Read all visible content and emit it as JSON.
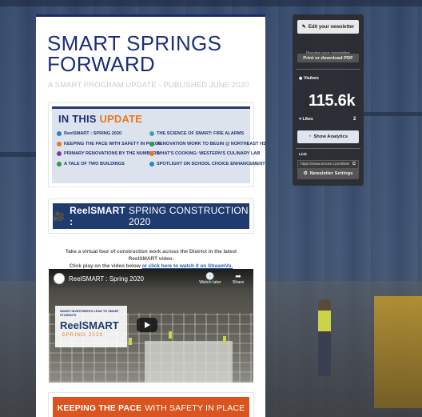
{
  "newsletter": {
    "title": "SMART SPRINGS FORWARD",
    "subtitle": "A SMART PROGRAM UPDATE - PUBLISHED JUNE 2020",
    "toc": {
      "heading_prefix": "IN THIS",
      "heading_accent": "UPDATE",
      "left_items": [
        {
          "label": "ReelSMART : SPRING 2020",
          "color": "#2a7fd0"
        },
        {
          "label": "KEEPING THE PACE WITH SAFETY IN PLACE",
          "color": "#e87722"
        },
        {
          "label": "PRIMARY RENOVATIONS BY THE NUMBERS",
          "color": "#7b3fa0"
        },
        {
          "label": "A TALE OF TWO BUILDINGS",
          "color": "#2f9a4a"
        }
      ],
      "right_items": [
        {
          "label": "THE SCIENCE OF SMART: FIRE ALARMS",
          "color": "#3aa6b0"
        },
        {
          "label": "RENOVATION WORK TO BEGIN @ NORTHEAST HS",
          "color": "#2f9a4a"
        },
        {
          "label": "WHAT'S COOKING: WESTERN'S CULINARY LAB",
          "color": "#e87722"
        },
        {
          "label": "SPOTLIGHT ON SCHOOL CHOICE ENHANCEMENTS",
          "color": "#2a7fd0"
        }
      ]
    },
    "reel_banner": {
      "bold": "ReelSMART :",
      "rest": "SPRING CONSTRUCTION 2020"
    },
    "intro": {
      "line1": "Take a virtual tour of construction work across the District in the latest ReelSMART video.",
      "line2_prefix": "Click play on the video below",
      "line2_link": "or click here to watch it on StreamVu."
    },
    "video": {
      "title": "ReelSMART : Spring 2020",
      "watch_later": "Watch later",
      "share": "Share",
      "card_small": "SMART INVESTMENTS LEAD TO SMART STUDENTS",
      "card_big": "ReelSMART",
      "card_season": "SPRING 2020"
    },
    "keep_banner": {
      "bold": "KEEPING THE PACE",
      "rest": "WITH SAFETY IN PLACE"
    }
  },
  "side_panel": {
    "edit_button": "Edit your newsletter",
    "preview_text": "Preview your newsletter",
    "print_button": "Print or download PDF",
    "visitors_label": "Visitors",
    "visitors_value": "115.6k",
    "likes_label": "Likes",
    "likes_value": "2",
    "analytics_button": "Show Analytics",
    "link_label": "Link",
    "link_value": "https://www.smore.com/sfw8",
    "settings_button": "Newsletter Settings"
  }
}
